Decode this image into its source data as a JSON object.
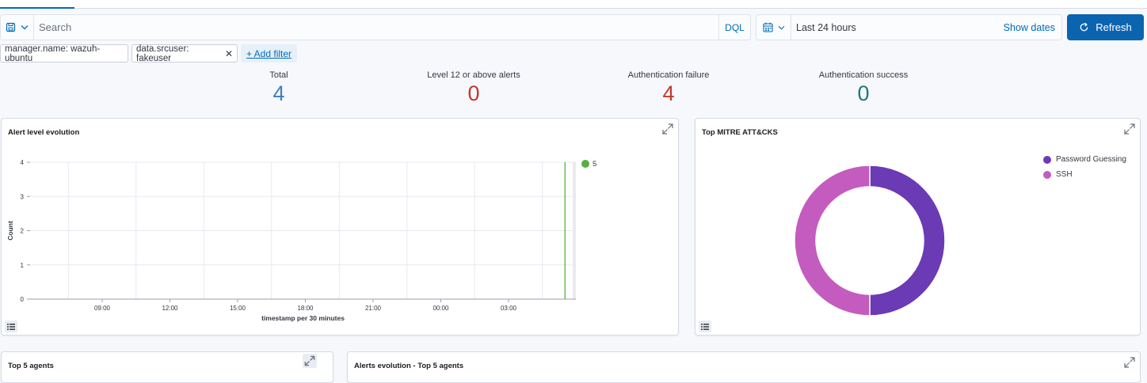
{
  "query": {
    "placeholder": "Search",
    "language": "DQL"
  },
  "time": {
    "range": "Last 24 hours",
    "show_dates": "Show dates",
    "refresh_label": "Refresh"
  },
  "filters": [
    {
      "label": "manager.name: wazuh-ubuntu"
    },
    {
      "label": "data.srcuser: fakeuser"
    }
  ],
  "add_filter_label": "+ Add filter",
  "metrics": [
    {
      "label": "Total",
      "value": "4",
      "color": "#3f7fc0"
    },
    {
      "label": "Level 12 or above alerts",
      "value": "0",
      "color": "#c2392b"
    },
    {
      "label": "Authentication failure",
      "value": "4",
      "color": "#c2392b"
    },
    {
      "label": "Authentication success",
      "value": "0",
      "color": "#1b7a7e"
    }
  ],
  "panels": {
    "alert_evolution": {
      "title": "Alert level evolution"
    },
    "mitre": {
      "title": "Top MITRE ATT&CKS"
    },
    "top_agents": {
      "title": "Top 5 agents"
    },
    "alerts_top_agents": {
      "title": "Alerts evolution - Top 5 agents"
    }
  },
  "chart_data": [
    {
      "type": "line",
      "title": "Alert level evolution",
      "xlabel": "timestamp per 30 minutes",
      "ylabel": "Count",
      "x_ticks": [
        "09:00",
        "12:00",
        "15:00",
        "18:00",
        "21:00",
        "00:00",
        "03:00"
      ],
      "y_ticks": [
        "0",
        "1",
        "2",
        "3",
        "4"
      ],
      "ylim": [
        0,
        4
      ],
      "grid": true,
      "legend_position": "right",
      "series": [
        {
          "name": "5",
          "color": "#54b03f",
          "values": [
            {
              "x": "05:30",
              "y": 4
            }
          ]
        }
      ]
    },
    {
      "type": "pie",
      "title": "Top MITRE ATT&CKS",
      "donut": true,
      "legend_position": "top-right",
      "slices": [
        {
          "label": "Password Guessing",
          "value": 2,
          "color": "#6b3ab5"
        },
        {
          "label": "SSH",
          "value": 2,
          "color": "#c45bbf"
        }
      ]
    }
  ]
}
